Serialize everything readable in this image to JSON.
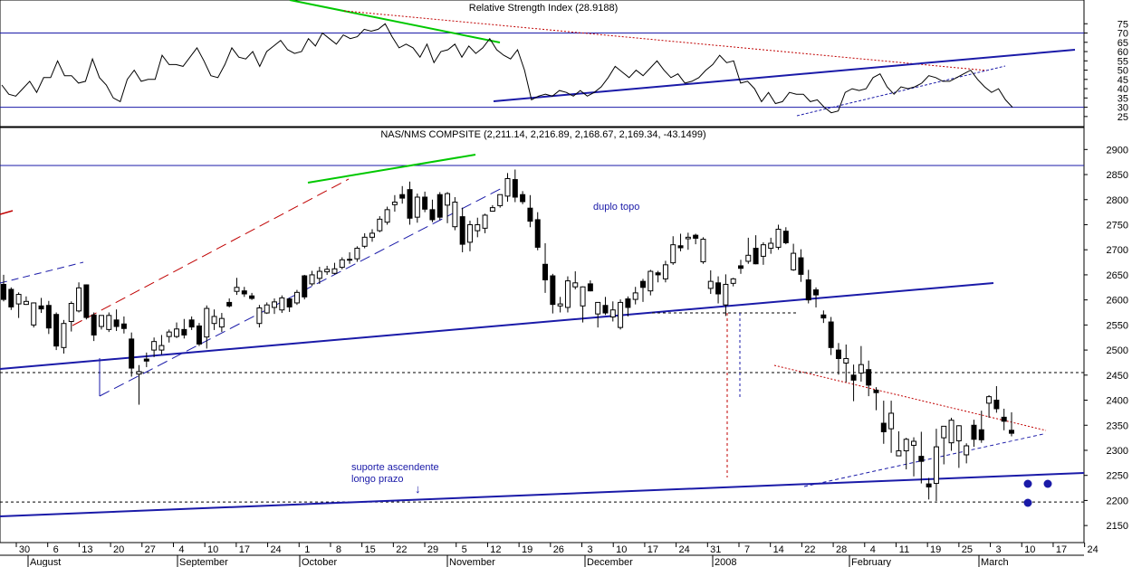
{
  "chart_data": [
    {
      "type": "line",
      "title": "Relative Strength Index (28.9188)",
      "ylim": [
        22,
        80
      ],
      "y_ticks": [
        25,
        30,
        35,
        40,
        45,
        50,
        55,
        60,
        65,
        70,
        75
      ],
      "overbought": 70,
      "oversold": 30,
      "grid": false,
      "series": [
        {
          "values": [
            42,
            37,
            36,
            40,
            44,
            38,
            46,
            46,
            55,
            47,
            47,
            43,
            44,
            56,
            46,
            42,
            35,
            33,
            45,
            50,
            44,
            45,
            45,
            58,
            53,
            53,
            52,
            57,
            62,
            55,
            47,
            46,
            53,
            62,
            57,
            56,
            60,
            52,
            60,
            63,
            66,
            61,
            59,
            60,
            67,
            63,
            70,
            67,
            64,
            69,
            67,
            68,
            72,
            71,
            72,
            75,
            68,
            62,
            64,
            62,
            57,
            64,
            54,
            60,
            61,
            64,
            57,
            63,
            59,
            62,
            67,
            61,
            58,
            56,
            61,
            50,
            34,
            36,
            37,
            36,
            39,
            38,
            36,
            39,
            36,
            38,
            41,
            46,
            52,
            49,
            46,
            50,
            47,
            51,
            55,
            50,
            46,
            48,
            43,
            44,
            46,
            50,
            53,
            58,
            54,
            55,
            43,
            44,
            40,
            33,
            38,
            32,
            33,
            38,
            37,
            37,
            33,
            34,
            30,
            27,
            28,
            38,
            40,
            39,
            40,
            46,
            48,
            41,
            37,
            41,
            40,
            41,
            43,
            47,
            46,
            44,
            44,
            46,
            48,
            50,
            45,
            41,
            38,
            40,
            34,
            30
          ]
        }
      ],
      "annotations": [
        "trend line (green)",
        "support line (blue)"
      ]
    },
    {
      "type": "candlestick",
      "title": "NAS/NMS COMPSITE (2,211.14, 2,216.89, 2,168.67, 2,169.34, -43.1499)",
      "ylim": [
        2125,
        2915
      ],
      "y_ticks": [
        2150,
        2200,
        2250,
        2300,
        2350,
        2400,
        2450,
        2500,
        2550,
        2600,
        2650,
        2700,
        2750,
        2800,
        2850,
        2900
      ],
      "x_tick_labels": [
        "30",
        "6",
        "13",
        "20",
        "27",
        "4",
        "10",
        "17",
        "24",
        "1",
        "8",
        "15",
        "22",
        "29",
        "5",
        "12",
        "19",
        "26",
        "3",
        "10",
        "17",
        "24",
        "31",
        "7",
        "14",
        "22",
        "28",
        "4",
        "11",
        "19",
        "25",
        "3",
        "10",
        "17",
        "24"
      ],
      "month_labels": [
        "August",
        "September",
        "October",
        "November",
        "December",
        "2008",
        "February",
        "March"
      ],
      "grid": false,
      "candles": [
        [
          2631,
          2650,
          2597,
          2601
        ],
        [
          2621,
          2625,
          2580,
          2586
        ],
        [
          2592,
          2615,
          2564,
          2611
        ],
        [
          2591,
          2607,
          2590,
          2597
        ],
        [
          2550,
          2595,
          2545,
          2594
        ],
        [
          2588,
          2604,
          2574,
          2582
        ],
        [
          2589,
          2598,
          2532,
          2544
        ],
        [
          2571,
          2575,
          2500,
          2508
        ],
        [
          2505,
          2560,
          2493,
          2553
        ],
        [
          2557,
          2597,
          2537,
          2593
        ],
        [
          2578,
          2635,
          2575,
          2624
        ],
        [
          2630,
          2631,
          2561,
          2565
        ],
        [
          2570,
          2575,
          2518,
          2530
        ],
        [
          2547,
          2569,
          2541,
          2569
        ],
        [
          2541,
          2575,
          2536,
          2569
        ],
        [
          2560,
          2581,
          2538,
          2547
        ],
        [
          2552,
          2567,
          2533,
          2543
        ],
        [
          2522,
          2535,
          2447,
          2464
        ],
        [
          2452,
          2470,
          2391,
          2457
        ],
        [
          2482,
          2495,
          2466,
          2478
        ],
        [
          2500,
          2525,
          2486,
          2517
        ],
        [
          2500,
          2530,
          2491,
          2509
        ],
        [
          2527,
          2541,
          2515,
          2536
        ],
        [
          2527,
          2555,
          2524,
          2542
        ],
        [
          2541,
          2562,
          2523,
          2530
        ],
        [
          2560,
          2567,
          2540,
          2546
        ],
        [
          2548,
          2554,
          2508,
          2512
        ],
        [
          2526,
          2589,
          2503,
          2583
        ],
        [
          2553,
          2581,
          2540,
          2567
        ],
        [
          2546,
          2574,
          2536,
          2563
        ],
        [
          2595,
          2603,
          2585,
          2588
        ],
        [
          2617,
          2644,
          2610,
          2625
        ],
        [
          2618,
          2626,
          2606,
          2612
        ],
        [
          2608,
          2614,
          2600,
          2603
        ],
        [
          2553,
          2590,
          2545,
          2584
        ],
        [
          2574,
          2595,
          2572,
          2590
        ],
        [
          2585,
          2603,
          2572,
          2596
        ],
        [
          2580,
          2609,
          2574,
          2604
        ],
        [
          2602,
          2604,
          2576,
          2586
        ],
        [
          2594,
          2620,
          2590,
          2615
        ],
        [
          2648,
          2650,
          2601,
          2606
        ],
        [
          2632,
          2658,
          2628,
          2650
        ],
        [
          2643,
          2666,
          2632,
          2657
        ],
        [
          2656,
          2668,
          2650,
          2661
        ],
        [
          2653,
          2674,
          2651,
          2662
        ],
        [
          2665,
          2685,
          2661,
          2680
        ],
        [
          2680,
          2695,
          2672,
          2681
        ],
        [
          2682,
          2707,
          2676,
          2703
        ],
        [
          2707,
          2733,
          2703,
          2725
        ],
        [
          2725,
          2741,
          2716,
          2733
        ],
        [
          2738,
          2767,
          2735,
          2761
        ],
        [
          2755,
          2786,
          2750,
          2780
        ],
        [
          2790,
          2809,
          2776,
          2795
        ],
        [
          2810,
          2827,
          2792,
          2803
        ],
        [
          2820,
          2836,
          2750,
          2763
        ],
        [
          2765,
          2812,
          2754,
          2805
        ],
        [
          2805,
          2816,
          2775,
          2781
        ],
        [
          2780,
          2800,
          2755,
          2760
        ],
        [
          2810,
          2815,
          2759,
          2765
        ],
        [
          2789,
          2815,
          2753,
          2812
        ],
        [
          2746,
          2805,
          2739,
          2795
        ],
        [
          2766,
          2784,
          2695,
          2711
        ],
        [
          2715,
          2758,
          2697,
          2750
        ],
        [
          2738,
          2764,
          2725,
          2750
        ],
        [
          2743,
          2772,
          2733,
          2769
        ],
        [
          2777,
          2789,
          2777,
          2784
        ],
        [
          2788,
          2810,
          2784,
          2810
        ],
        [
          2807,
          2853,
          2796,
          2842
        ],
        [
          2840,
          2860,
          2795,
          2805
        ],
        [
          2810,
          2817,
          2791,
          2796
        ],
        [
          2783,
          2809,
          2745,
          2757
        ],
        [
          2760,
          2775,
          2699,
          2705
        ],
        [
          2671,
          2713,
          2614,
          2640
        ],
        [
          2648,
          2652,
          2573,
          2591
        ],
        [
          2588,
          2606,
          2575,
          2592
        ],
        [
          2585,
          2647,
          2575,
          2638
        ],
        [
          2626,
          2657,
          2621,
          2634
        ],
        [
          2588,
          2627,
          2555,
          2626
        ],
        [
          2632,
          2639,
          2617,
          2618
        ],
        [
          2572,
          2590,
          2545,
          2595
        ],
        [
          2589,
          2606,
          2570,
          2574
        ],
        [
          2566,
          2597,
          2557,
          2580
        ],
        [
          2545,
          2601,
          2541,
          2595
        ],
        [
          2602,
          2607,
          2567,
          2585
        ],
        [
          2601,
          2626,
          2591,
          2614
        ],
        [
          2637,
          2642,
          2596,
          2625
        ],
        [
          2618,
          2660,
          2609,
          2657
        ],
        [
          2654,
          2658,
          2635,
          2650
        ],
        [
          2642,
          2678,
          2635,
          2670
        ],
        [
          2674,
          2727,
          2670,
          2710
        ],
        [
          2708,
          2732,
          2697,
          2704
        ],
        [
          2722,
          2734,
          2700,
          2725
        ],
        [
          2729,
          2732,
          2711,
          2723
        ],
        [
          2676,
          2725,
          2672,
          2721
        ],
        [
          2623,
          2659,
          2612,
          2637
        ],
        [
          2634,
          2647,
          2593,
          2612
        ],
        [
          2590,
          2651,
          2568,
          2631
        ],
        [
          2633,
          2644,
          2627,
          2642
        ],
        [
          2668,
          2680,
          2652,
          2663
        ],
        [
          2677,
          2724,
          2672,
          2689
        ],
        [
          2703,
          2729,
          2671,
          2672
        ],
        [
          2687,
          2715,
          2670,
          2710
        ],
        [
          2703,
          2724,
          2692,
          2713
        ],
        [
          2705,
          2750,
          2700,
          2741
        ],
        [
          2737,
          2745,
          2711,
          2714
        ],
        [
          2660,
          2712,
          2658,
          2693
        ],
        [
          2684,
          2701,
          2636,
          2651
        ],
        [
          2640,
          2660,
          2593,
          2600
        ],
        [
          2620,
          2625,
          2585,
          2610
        ],
        [
          2570,
          2579,
          2554,
          2564
        ],
        [
          2556,
          2566,
          2490,
          2505
        ],
        [
          2500,
          2514,
          2451,
          2483
        ],
        [
          2474,
          2511,
          2436,
          2483
        ],
        [
          2450,
          2471,
          2398,
          2440
        ],
        [
          2454,
          2508,
          2437,
          2471
        ],
        [
          2461,
          2479,
          2408,
          2430
        ],
        [
          2420,
          2426,
          2380,
          2415
        ],
        [
          2354,
          2399,
          2313,
          2337
        ],
        [
          2343,
          2399,
          2295,
          2374
        ],
        [
          2289,
          2338,
          2292,
          2299
        ],
        [
          2299,
          2325,
          2262,
          2322
        ],
        [
          2310,
          2326,
          2248,
          2318
        ],
        [
          2288,
          2337,
          2234,
          2278
        ],
        [
          2233,
          2245,
          2202,
          2227
        ],
        [
          2234,
          2343,
          2199,
          2307
        ],
        [
          2325,
          2347,
          2272,
          2348
        ],
        [
          2315,
          2365,
          2299,
          2360
        ],
        [
          2319,
          2350,
          2265,
          2349
        ],
        [
          2291,
          2314,
          2274,
          2309
        ],
        [
          2350,
          2361,
          2307,
          2322
        ],
        [
          2341,
          2379,
          2315,
          2321
        ],
        [
          2394,
          2410,
          2365,
          2407
        ],
        [
          2400,
          2428,
          2375,
          2383
        ],
        [
          2366,
          2383,
          2340,
          2358
        ],
        [
          2340,
          2376,
          2328,
          2334
        ]
      ],
      "annotations": [
        {
          "text": "duplo topo"
        },
        {
          "text": "suporte ascendente"
        },
        {
          "text": "longo prazo"
        },
        {
          "text": "↓"
        }
      ]
    }
  ]
}
